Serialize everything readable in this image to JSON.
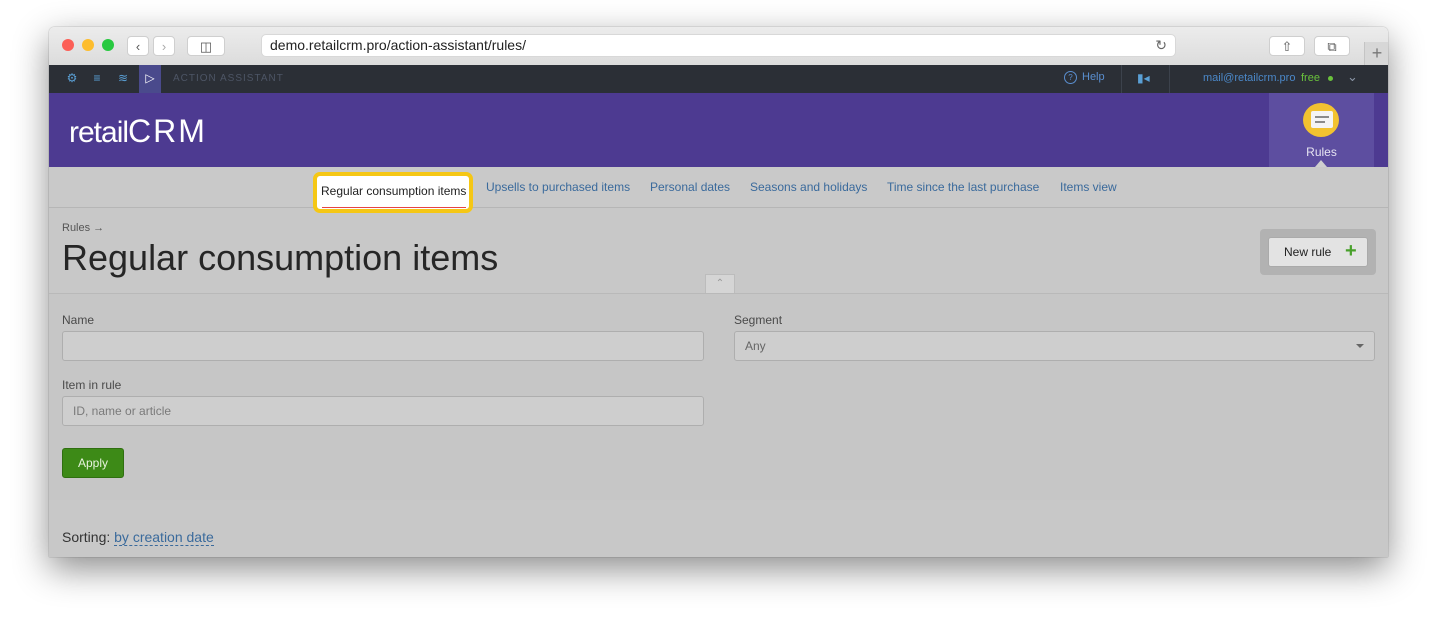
{
  "browser": {
    "url": "demo.retailcrm.pro/action-assistant/rules/"
  },
  "topbar": {
    "section_title": "ACTION ASSISTANT",
    "help_label": "Help",
    "user_email": "mail@retailcrm.pro",
    "plan_label": "free"
  },
  "header": {
    "logo_text_a": "retail",
    "logo_text_b": "CRM",
    "rules_tile_label": "Rules"
  },
  "subnav": {
    "tabs": [
      {
        "label": "Regular consumption items",
        "active": true
      },
      {
        "label": "Upsells to purchased items"
      },
      {
        "label": "Personal dates"
      },
      {
        "label": "Seasons and holidays"
      },
      {
        "label": "Time since the last purchase"
      },
      {
        "label": "Items view"
      }
    ]
  },
  "page": {
    "breadcrumb": "Rules →",
    "title": "Regular consumption items",
    "new_rule_label": "New rule",
    "new_rule_icon": "+"
  },
  "filters": {
    "name_label": "Name",
    "name_value": "",
    "segment_label": "Segment",
    "segment_value": "Any",
    "item_label": "Item in rule",
    "item_placeholder": "ID, name or article",
    "apply_label": "Apply"
  },
  "sorting": {
    "label": "Sorting:",
    "value": "by creation date"
  },
  "colors": {
    "header_purple": "#4d3a91",
    "highlight_yellow": "#f5c715",
    "apply_green": "#3d8a17",
    "link_blue": "#3a6a9c"
  }
}
